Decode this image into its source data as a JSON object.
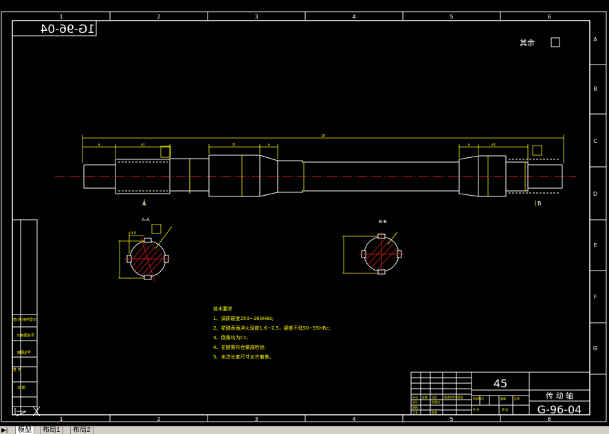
{
  "drawing": {
    "drawing_number_mirrored": "1G-96-04",
    "drawing_number": "G-96-04",
    "roughness_note": "其余",
    "material": "45",
    "part_name": "传 动 轴",
    "grid_columns": [
      "1",
      "2",
      "3",
      "4",
      "5",
      "6"
    ],
    "grid_rows": [
      "A",
      "B",
      "C",
      "D",
      "E",
      "F",
      "G"
    ],
    "section_a_label": "A",
    "section_a_title": "A-A",
    "section_b_title": "B-B",
    "section_b_mark": "B",
    "tech_requirements": {
      "title": "技术要求",
      "items": [
        "1、调质硬度250~280HBs;",
        "2、花键表面淬火深度1.6~2.5，硬度不低50~55HRc;",
        "3、倒角均为C1;",
        "4、花键需符合量规检验;",
        "5、未注长度尺寸允许偏差。"
      ]
    },
    "left_sidebar": [
      "借(通)用件登记",
      "旧底图总号",
      "底图总号",
      "签 字",
      "日 期"
    ],
    "title_block_labels": [
      "标记",
      "处数",
      "分区",
      "更改文件号",
      "签名",
      "年月日",
      "设计",
      "标准化",
      "审核",
      "工艺",
      "批准",
      "阶段标记",
      "重量",
      "比例",
      "共 张",
      "第 张"
    ]
  },
  "tabs": {
    "model": "模型",
    "layout1": "布局1",
    "layout2": "布局2"
  }
}
